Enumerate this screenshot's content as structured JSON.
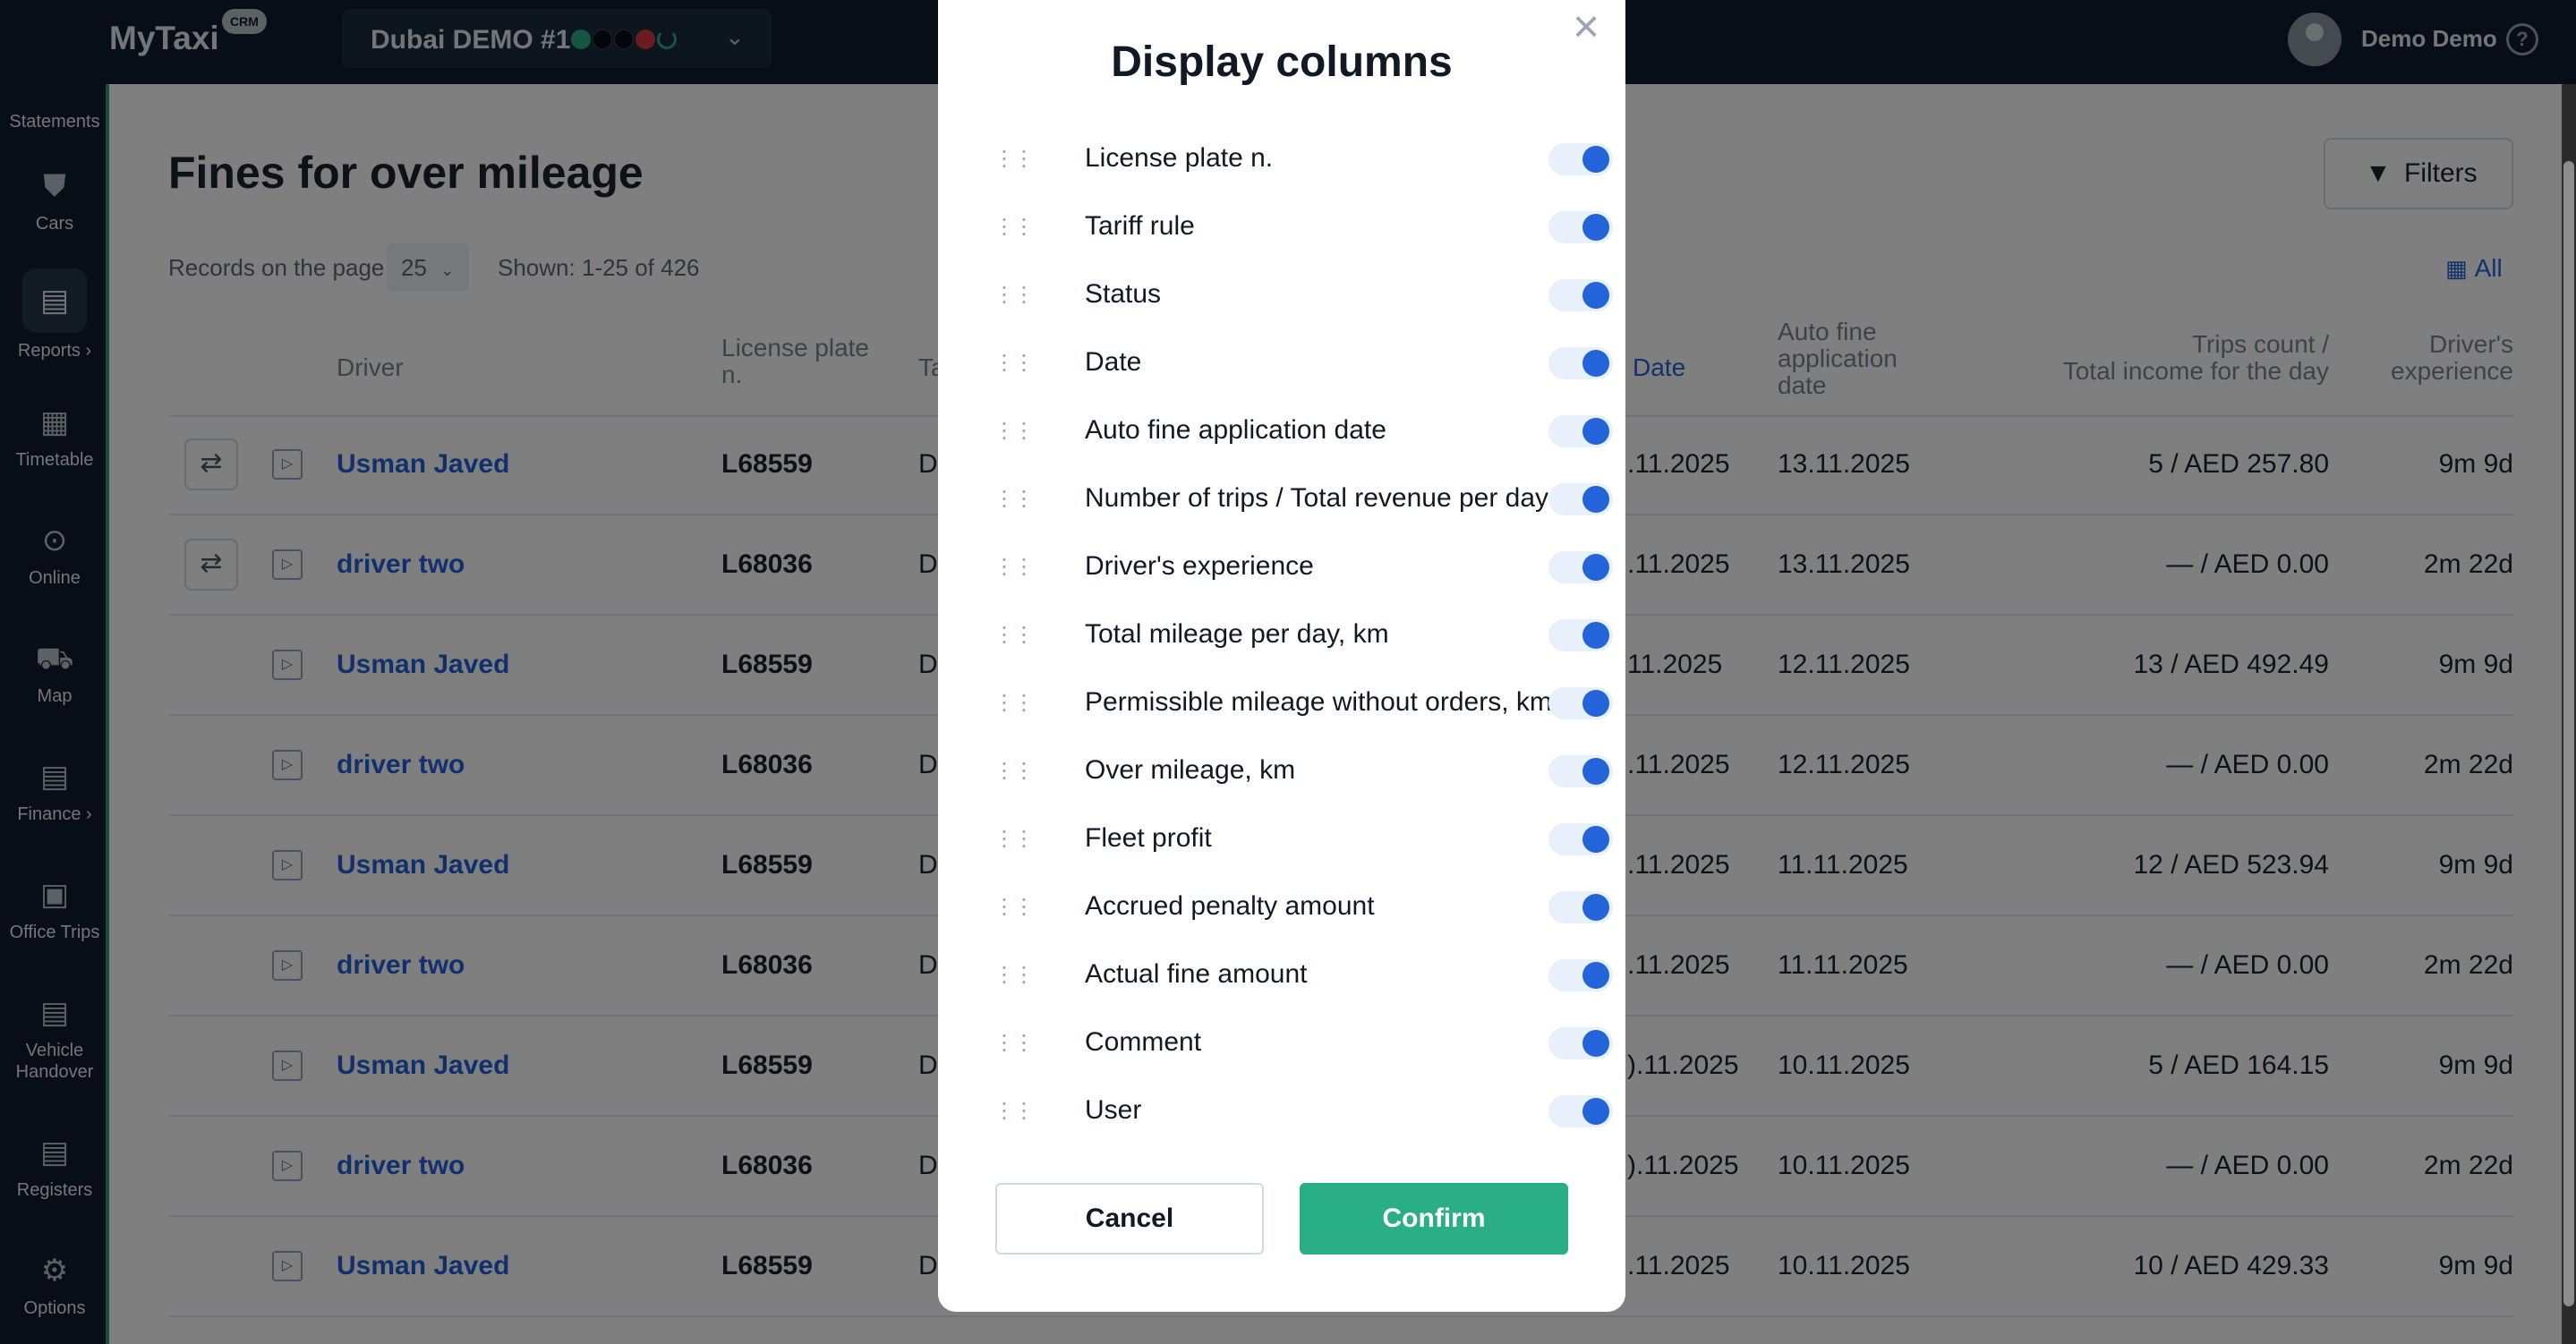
{
  "header": {
    "logo": "MyTaxi",
    "logo_badge": "CRM",
    "park_name": "Dubai DEMO #1",
    "user_name": "Demo Demo"
  },
  "sidebar": {
    "items": [
      {
        "label": "Statements",
        "icon": "statements-icon"
      },
      {
        "label": "Cars",
        "icon": "car-icon"
      },
      {
        "label": "Reports",
        "icon": "clipboard-icon"
      },
      {
        "label": "Timetable",
        "icon": "calendar-icon"
      },
      {
        "label": "Online",
        "icon": "broadcast-icon"
      },
      {
        "label": "Map",
        "icon": "map-icon"
      },
      {
        "label": "Finance",
        "icon": "finance-icon"
      },
      {
        "label": "Office Trips",
        "icon": "briefcase-icon"
      },
      {
        "label": "Vehicle",
        "label2": "Handover",
        "icon": "clipboard-icon"
      },
      {
        "label": "Registers",
        "icon": "clipboard-icon"
      },
      {
        "label": "Options",
        "icon": "gear-icon"
      }
    ]
  },
  "page": {
    "title": "Fines for over mileage",
    "filters_label": "Filters",
    "records_label": "Records on the page",
    "records_value": "25",
    "shown": "Shown: 1-25 of 426",
    "all_label": "All"
  },
  "table": {
    "headers": {
      "driver": "Driver",
      "plate_1": "License plate",
      "plate_2": "n.",
      "tariff": "Ta",
      "date": "Date",
      "auto_1": "Auto fine",
      "auto_2": "application",
      "auto_3": "date",
      "trips_1": "Trips count /",
      "trips_2": "Total income for the day",
      "exp_1": "Driver's",
      "exp_2": "experience"
    },
    "rows": [
      {
        "driver": "Usman Javed",
        "plate": "L68559",
        "tariff": "De",
        "date": ".11.2025",
        "auto_date": "13.11.2025",
        "trips": "5 / AED 257.80",
        "exp": "9m 9d"
      },
      {
        "driver": "driver two",
        "plate": "L68036",
        "tariff": "De",
        "date": ".11.2025",
        "auto_date": "13.11.2025",
        "trips": "— / AED 0.00",
        "exp": "2m 22d"
      },
      {
        "driver": "Usman Javed",
        "plate": "L68559",
        "tariff": "De",
        "date": "11.2025",
        "auto_date": "12.11.2025",
        "trips": "13 / AED 492.49",
        "exp": "9m 9d"
      },
      {
        "driver": "driver two",
        "plate": "L68036",
        "tariff": "De",
        "date": ".11.2025",
        "auto_date": "12.11.2025",
        "trips": "— / AED 0.00",
        "exp": "2m 22d"
      },
      {
        "driver": "Usman Javed",
        "plate": "L68559",
        "tariff": "De",
        "date": ".11.2025",
        "auto_date": "11.11.2025",
        "trips": "12 / AED 523.94",
        "exp": "9m 9d"
      },
      {
        "driver": "driver two",
        "plate": "L68036",
        "tariff": "De",
        "date": ".11.2025",
        "auto_date": "11.11.2025",
        "trips": "— / AED 0.00",
        "exp": "2m 22d"
      },
      {
        "driver": "Usman Javed",
        "plate": "L68559",
        "tariff": "De",
        "date": ").11.2025",
        "auto_date": "10.11.2025",
        "trips": "5 / AED 164.15",
        "exp": "9m 9d"
      },
      {
        "driver": "driver two",
        "plate": "L68036",
        "tariff": "De",
        "date": ").11.2025",
        "auto_date": "10.11.2025",
        "trips": "— / AED 0.00",
        "exp": "2m 22d"
      },
      {
        "driver": "Usman Javed",
        "plate": "L68559",
        "tariff": "De",
        "date": ".11.2025",
        "auto_date": "10.11.2025",
        "trips": "10 / AED 429.33",
        "exp": "9m 9d"
      }
    ]
  },
  "modal": {
    "title": "Display columns",
    "columns": [
      {
        "label": "License plate n.",
        "enabled": true
      },
      {
        "label": "Tariff rule",
        "enabled": true
      },
      {
        "label": "Status",
        "enabled": true
      },
      {
        "label": "Date",
        "enabled": true
      },
      {
        "label": "Auto fine application date",
        "enabled": true
      },
      {
        "label": "Number of trips / Total revenue per day",
        "enabled": true
      },
      {
        "label": "Driver's experience",
        "enabled": true
      },
      {
        "label": "Total mileage per day, km",
        "enabled": true
      },
      {
        "label": "Permissible mileage without orders, km",
        "enabled": true
      },
      {
        "label": "Over mileage, km",
        "enabled": true
      },
      {
        "label": "Fleet profit",
        "enabled": true
      },
      {
        "label": "Accrued penalty amount",
        "enabled": true
      },
      {
        "label": "Actual fine amount",
        "enabled": true
      },
      {
        "label": "Comment",
        "enabled": true
      },
      {
        "label": "User",
        "enabled": true
      }
    ],
    "cancel_label": "Cancel",
    "confirm_label": "Confirm"
  },
  "colors": {
    "topbar": "#0f1c2e",
    "link": "#2563d9",
    "confirm": "#2aae86",
    "toggle_on": "#2563d9"
  }
}
